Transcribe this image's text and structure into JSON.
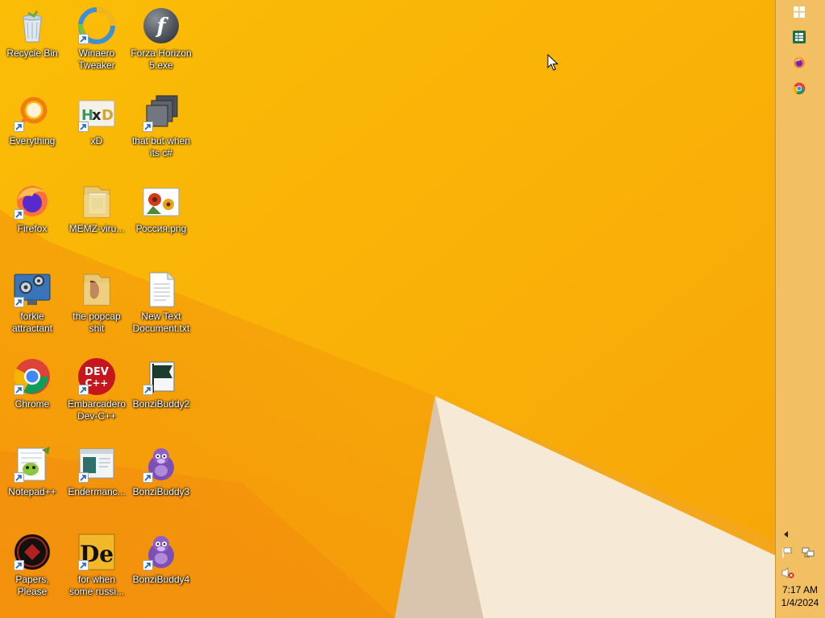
{
  "desktop": {
    "icons": [
      {
        "label": "Recycle Bin",
        "icon": "recycle-bin-icon"
      },
      {
        "label": "Winaero Tweaker",
        "icon": "winaero-tweaker-icon"
      },
      {
        "label": "Forza Horizon 5.exe",
        "icon": "flash-player-icon"
      },
      {
        "label": "Everything",
        "icon": "everything-search-icon"
      },
      {
        "label": "xD",
        "icon": "hxd-hex-editor-icon"
      },
      {
        "label": "that but when its c#",
        "icon": "stacked-windows-icon"
      },
      {
        "label": "Firefox",
        "icon": "firefox-icon"
      },
      {
        "label": "MEMZ-viru...",
        "icon": "folder-icon"
      },
      {
        "label": "Россия.png",
        "icon": "flower-image-icon"
      },
      {
        "label": "forkie attractant",
        "icon": "control-panel-gears-icon"
      },
      {
        "label": "the popcap shit",
        "icon": "folder-icon"
      },
      {
        "label": "New Text Document.txt",
        "icon": "text-document-icon"
      },
      {
        "label": "Chrome",
        "icon": "chrome-icon"
      },
      {
        "label": "Embarcadero Dev-C++",
        "icon": "dev-cpp-icon"
      },
      {
        "label": "BonziBuddy2",
        "icon": "flag-file-icon"
      },
      {
        "label": "Notepad++",
        "icon": "notepad-plus-plus-icon"
      },
      {
        "label": "Endermanc...",
        "icon": "window-app-icon"
      },
      {
        "label": "BonziBuddy3",
        "icon": "bonzi-buddy-icon"
      },
      {
        "label": "Papers, Please",
        "icon": "papers-please-icon"
      },
      {
        "label": "for when some russi...",
        "icon": "de-app-icon"
      },
      {
        "label": "BonziBuddy4",
        "icon": "bonzi-buddy-icon"
      }
    ]
  },
  "taskbar": {
    "pinned": [
      {
        "name": "start-button",
        "icon": "windows-logo-icon"
      },
      {
        "name": "excel",
        "icon": "excel-icon"
      },
      {
        "name": "firefox",
        "icon": "firefox-icon"
      },
      {
        "name": "chrome",
        "icon": "chrome-icon"
      }
    ],
    "clock": {
      "time": "7:17 AM",
      "date": "1/4/2024"
    }
  },
  "colors": {
    "wallpaper": "#f9b208",
    "taskbar": "#f2c063",
    "accent_light": "#f5e6d2"
  }
}
